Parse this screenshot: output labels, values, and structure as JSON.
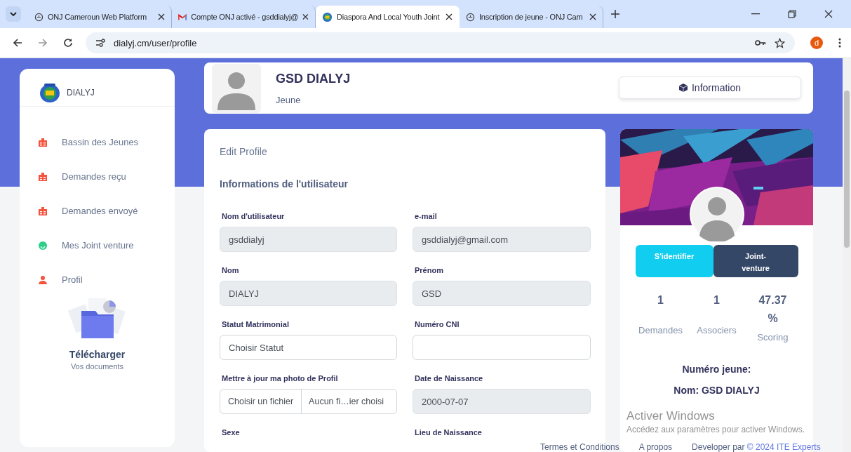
{
  "browser": {
    "tabs": [
      {
        "title": "ONJ Cameroun Web Platform",
        "kind": "globe",
        "selected": false
      },
      {
        "title": "Compte ONJ activé - gsddialyj@",
        "kind": "mail",
        "selected": false
      },
      {
        "title": "Diaspora And Local Youth Joint",
        "kind": "emblem",
        "selected": true
      },
      {
        "title": "Inscription de jeune - ONJ Cam",
        "kind": "globe",
        "selected": false
      }
    ],
    "url": "dialyj.cm/user/profile",
    "profile_initial": "d"
  },
  "sidebar": {
    "brand": "DIALYJ",
    "items": [
      {
        "label": "Bassin des Jeunes",
        "kind": "badge",
        "color": "#f5533d"
      },
      {
        "label": "Demandes reçu",
        "kind": "badge",
        "color": "#f5533d"
      },
      {
        "label": "Demandes envoyé",
        "kind": "badge",
        "color": "#f5533d"
      },
      {
        "label": "Mes Joint venture",
        "kind": "smile",
        "color": "#2dce89"
      },
      {
        "label": "Profil",
        "kind": "person",
        "color": "#f5533d"
      }
    ],
    "download": {
      "title": "Télécharger",
      "subtitle": "Vos documents"
    }
  },
  "header": {
    "name": "GSD DIALYJ",
    "role": "Jeune",
    "button": "Information"
  },
  "edit_profile": {
    "title": "Edit Profile",
    "section": "Informations de l'utilisateur",
    "fields": [
      {
        "label": "Nom d'utilisateur",
        "kind": "readonly",
        "value": "gsddialyj"
      },
      {
        "label": "e-mail",
        "kind": "readonly",
        "value": "gsddialyj@gmail.com"
      },
      {
        "label": "Nom",
        "kind": "readonly",
        "value": "DIALYJ"
      },
      {
        "label": "Prénom",
        "kind": "readonly",
        "value": "GSD"
      },
      {
        "label": "Statut Matrimonial",
        "kind": "select",
        "value": "Choisir Statut"
      },
      {
        "label": "Numéro CNI",
        "kind": "input"
      },
      {
        "label": "Mettre à jour ma photo de Profil",
        "kind": "file",
        "button": "Choisir un fichier",
        "value": "Aucun fi…ier choisi"
      },
      {
        "label": "Date de Naissance",
        "kind": "readonly",
        "value": "2000-07-07"
      },
      {
        "label": "Sexe",
        "kind": "label"
      },
      {
        "label": "Lieu de Naissance",
        "kind": "label"
      }
    ]
  },
  "profile_card": {
    "buttons": [
      {
        "label": "S'identifier",
        "kind": "primary"
      },
      {
        "label": "Joint-venture",
        "kind": "dark"
      }
    ],
    "stats": [
      {
        "value": "1",
        "label": "Demandes"
      },
      {
        "value": "1",
        "label": "Associers"
      },
      {
        "value": "47.37 %",
        "label": "Scoring"
      }
    ],
    "number_label": "Numéro jeune:",
    "name_line": "Nom: GSD DIALYJ"
  },
  "footer": {
    "links": [
      "Termes et Conditions",
      "A propos"
    ],
    "credit": "Developer par",
    "credit_link": "© 2024 ITE Experts"
  },
  "os_notice": {
    "title": "Activer Windows",
    "text": "Accédez aux paramètres pour activer Windows."
  }
}
